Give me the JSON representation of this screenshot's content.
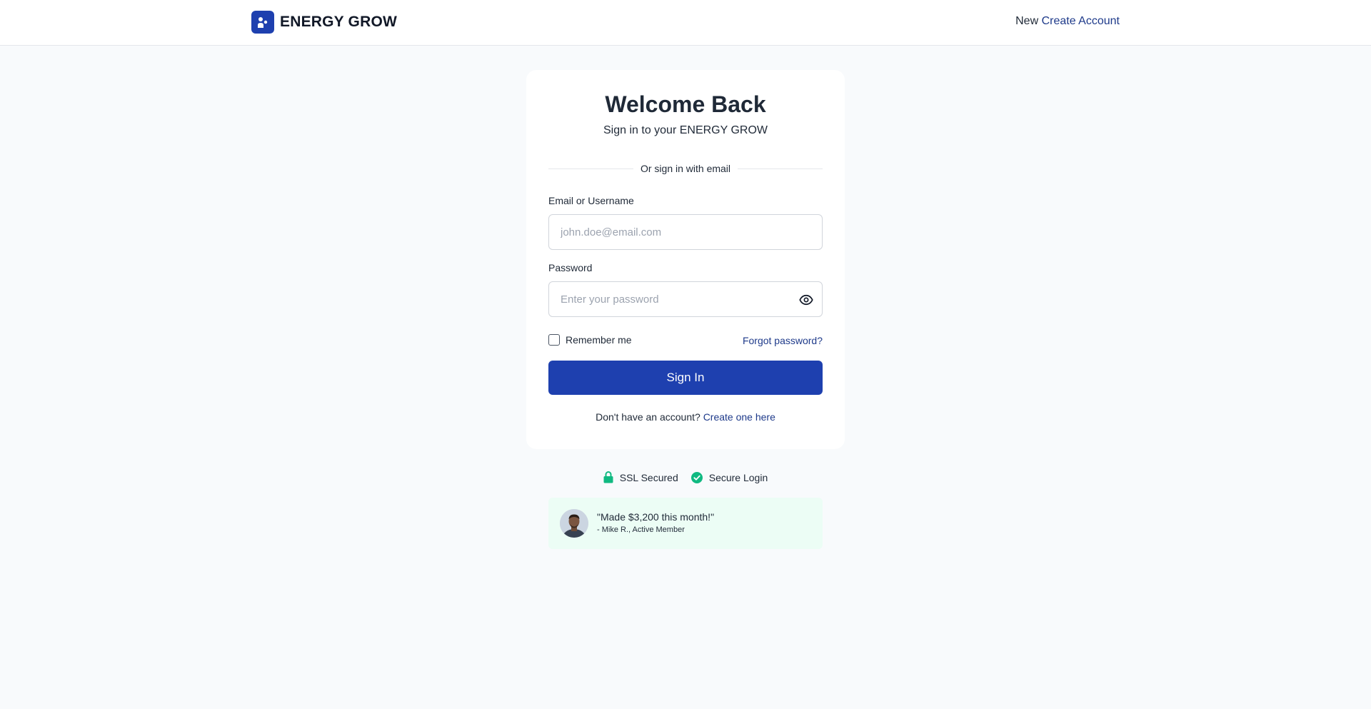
{
  "header": {
    "brand_name": "ENERGY GROW",
    "new_prefix": "New",
    "create_account_link": "Create Account"
  },
  "login": {
    "title": "Welcome Back",
    "subtitle": "Sign in to your ENERGY GROW",
    "divider_text": "Or sign in with email",
    "email_label": "Email or Username",
    "email_value": "",
    "email_placeholder": "john.doe@email.com",
    "password_label": "Password",
    "password_value": "",
    "password_placeholder": "Enter your password",
    "remember_label": "Remember me",
    "remember_checked": false,
    "forgot_link": "Forgot password?",
    "signin_button": "Sign In",
    "no_account_text": "Don't have an account?",
    "create_link": "Create one here"
  },
  "security": {
    "ssl_label": "SSL Secured",
    "secure_label": "Secure Login"
  },
  "testimonial": {
    "quote": "\"Made $3,200 this month!\"",
    "author": "- Mike R., Active Member"
  },
  "icons": {
    "brand": "user-app-icon",
    "password_toggle": "eye-icon",
    "ssl": "lock-icon",
    "secure": "check-circle-icon"
  },
  "colors": {
    "primary": "#1e40af",
    "link": "#1e3a8a",
    "success": "#10b981",
    "background": "#f8fafc",
    "testimonial_bg": "#ecfdf5"
  }
}
